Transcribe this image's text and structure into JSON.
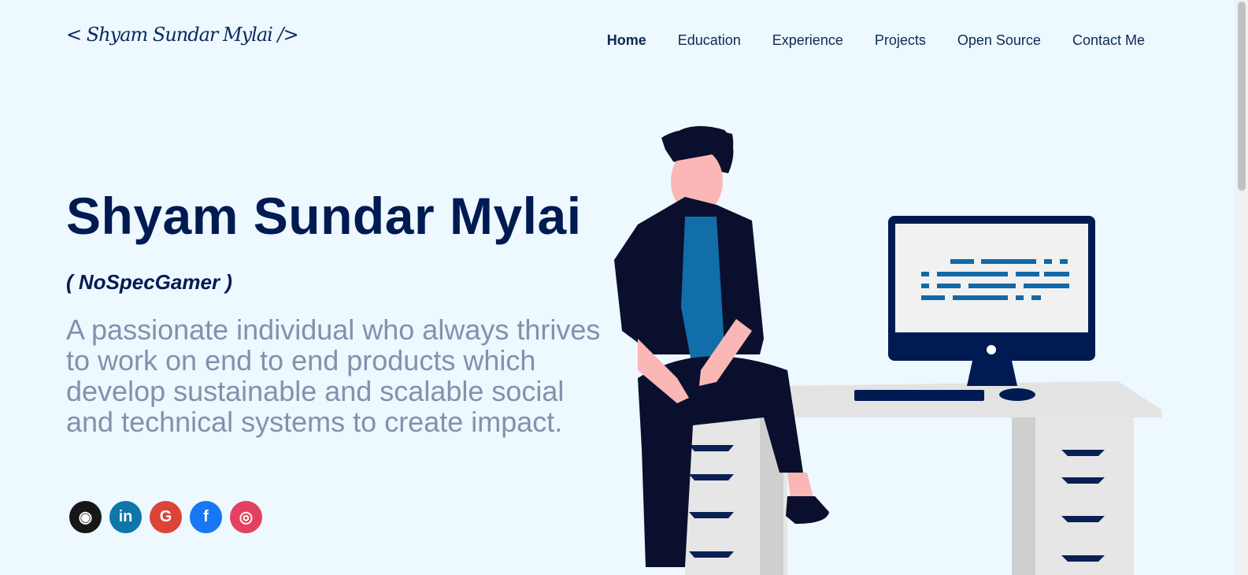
{
  "logo": "< Shyam Sundar Mylai />",
  "nav": [
    "Home",
    "Education",
    "Experience",
    "Projects",
    "Open Source",
    "Contact Me"
  ],
  "hero": {
    "name": "Shyam Sundar Mylai",
    "nickname": "( NoSpecGamer )",
    "description": "A passionate individual who always thrives to work on end to end products which develop sustainable and scalable social and technical systems to create impact."
  },
  "social": [
    {
      "icon": "github-icon",
      "glyph": "◉",
      "color": "#181717"
    },
    {
      "icon": "linkedin-icon",
      "glyph": "in",
      "color": "#0e76a8"
    },
    {
      "icon": "google-icon",
      "glyph": "G",
      "color": "#db4437"
    },
    {
      "icon": "facebook-icon",
      "glyph": "f",
      "color": "#1877f2"
    },
    {
      "icon": "instagram-icon",
      "glyph": "◎",
      "color": "#e4405f"
    }
  ]
}
